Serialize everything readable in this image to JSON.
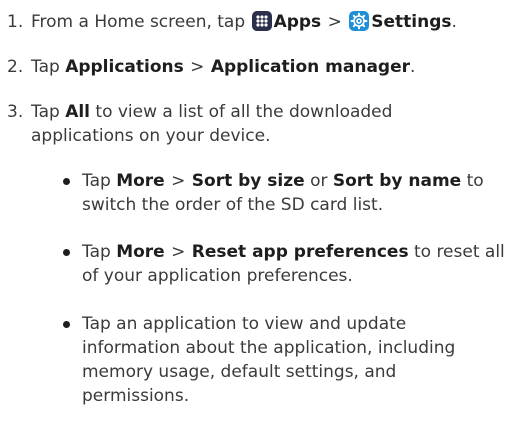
{
  "steps": [
    {
      "number": "1.",
      "text_a": "From a Home screen, tap",
      "apps_label": "Apps",
      "sep": ">",
      "settings_label": "Settings",
      "end": "."
    },
    {
      "number": "2.",
      "text_a": "Tap",
      "applications_label": "Applications",
      "sep": ">",
      "app_manager_label": "Application manager",
      "end": "."
    },
    {
      "number": "3.",
      "text_a": "Tap",
      "all_label": "All",
      "text_b": "to view a list of all the downloaded applications on your device."
    }
  ],
  "bullets": [
    {
      "text_a": "Tap",
      "more_label": "More",
      "sep": ">",
      "sort_size_label": "Sort by size",
      "or": "or",
      "sort_name_label": "Sort by name",
      "text_b": "to switch the order of the SD card list."
    },
    {
      "text_a": "Tap",
      "more_label": "More",
      "sep": ">",
      "reset_label": "Reset app preferences",
      "text_b": "to reset all of your application preferences."
    },
    {
      "text": "Tap an application to view and update information about the application, including memory usage, default settings, and permissions."
    }
  ],
  "icons": {
    "apps": "apps-grid-icon",
    "settings": "settings-gear-icon"
  },
  "colors": {
    "apps_icon": "#2a2f4a",
    "settings_icon": "#1f8fd8",
    "text": "#3a3a3a",
    "bold_text": "#1e1e1e"
  }
}
